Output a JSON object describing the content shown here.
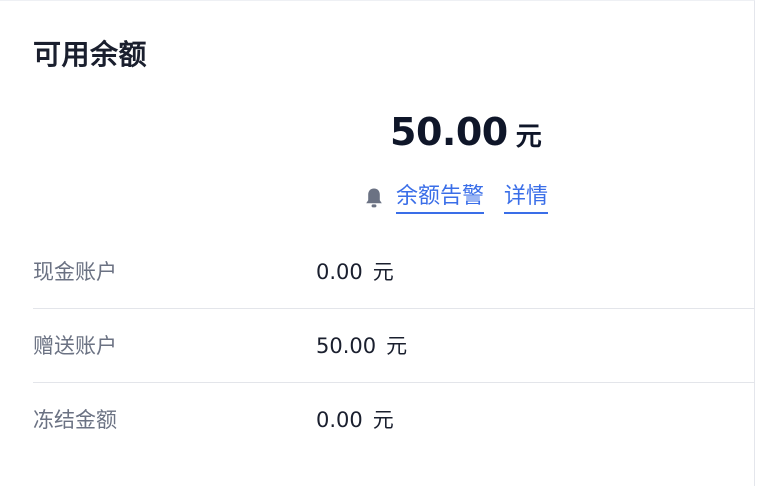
{
  "card": {
    "title": "可用余额"
  },
  "balance": {
    "amount": "50.00",
    "unit": "元"
  },
  "alert": {
    "icon": "bell-icon",
    "balance_alert_label": "余额告警",
    "details_label": "详情"
  },
  "accounts": [
    {
      "label": "现金账户",
      "amount": "0.00",
      "unit": "元"
    },
    {
      "label": "赠送账户",
      "amount": "50.00",
      "unit": "元"
    },
    {
      "label": "冻结金额",
      "amount": "0.00",
      "unit": "元"
    }
  ],
  "colors": {
    "link": "#3a6ee8",
    "title": "#1a1f2e",
    "label": "#6b7283",
    "divider": "#e3e5ea"
  }
}
